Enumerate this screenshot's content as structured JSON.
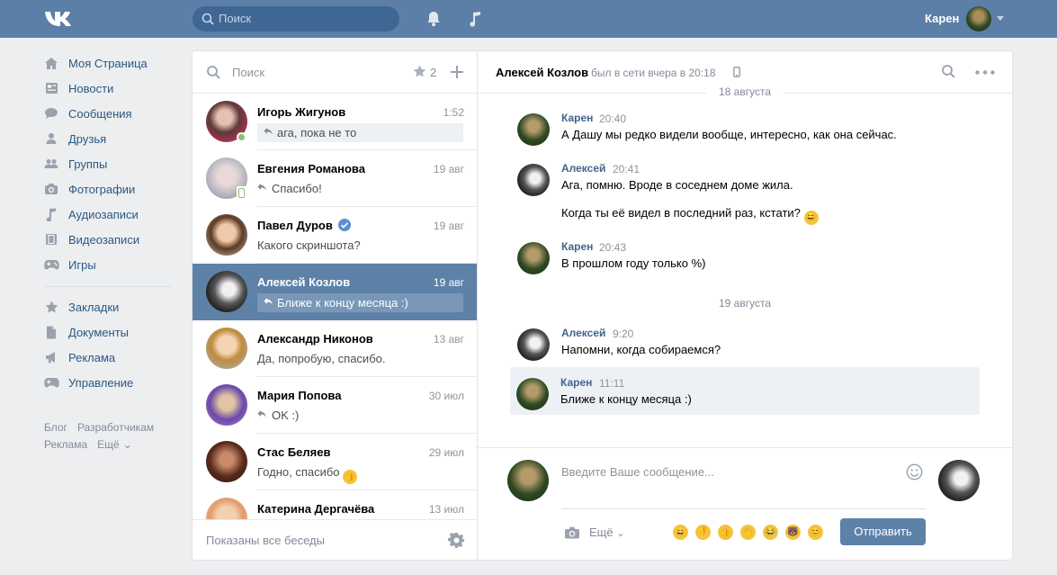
{
  "header": {
    "search_placeholder": "Поиск",
    "user_name": "Карен",
    "brand_color": "#5b7fa6"
  },
  "nav": {
    "items": [
      {
        "label": "Моя Страница",
        "icon": "house-icon"
      },
      {
        "label": "Новости",
        "icon": "news-icon"
      },
      {
        "label": "Сообщения",
        "icon": "message-bubble-icon"
      },
      {
        "label": "Друзья",
        "icon": "person-icon"
      },
      {
        "label": "Группы",
        "icon": "group-icon"
      },
      {
        "label": "Фотографии",
        "icon": "camera-icon"
      },
      {
        "label": "Аудиозаписи",
        "icon": "music-note-icon"
      },
      {
        "label": "Видеозаписи",
        "icon": "film-icon"
      },
      {
        "label": "Игры",
        "icon": "gamepad-icon"
      }
    ],
    "items2": [
      {
        "label": "Закладки",
        "icon": "star-icon"
      },
      {
        "label": "Документы",
        "icon": "document-icon"
      },
      {
        "label": "Реклама",
        "icon": "megaphone-icon"
      },
      {
        "label": "Управление",
        "icon": "gamepad-icon"
      }
    ],
    "footer": [
      "Блог",
      "Разработчикам",
      "Реклама",
      "Ещё"
    ]
  },
  "dialogs": {
    "search_placeholder": "Поиск",
    "favorites_count": "2",
    "items": [
      {
        "name": "Игорь Жигунов",
        "time": "1:52",
        "preview": "ага, пока не то",
        "avatar": "igor"
      },
      {
        "name": "Евгения Романова",
        "time": "19 авг",
        "preview": "Спасибо!",
        "avatar": "evg"
      },
      {
        "name": "Павел Дуров",
        "time": "19 авг",
        "preview": "Какого скриншота?",
        "avatar": "pavel"
      },
      {
        "name": "Алексей Козлов",
        "time": "19 авг",
        "preview": "Ближе к концу месяца :)",
        "avatar": "alexey"
      },
      {
        "name": "Александр Никонов",
        "time": "13 авг",
        "preview": "Да, попробую, спасибо.",
        "avatar": "alex"
      },
      {
        "name": "Мария Попова",
        "time": "30 июл",
        "preview": "OK :)",
        "avatar": "maria"
      },
      {
        "name": "Стас Беляев",
        "time": "29 июл",
        "preview": "Годно, спасибо",
        "avatar": "stas"
      },
      {
        "name": "Катерина Дергачёва",
        "time": "13 июл",
        "preview": "",
        "avatar": "kat"
      }
    ],
    "footer_text": "Показаны все беседы"
  },
  "chat": {
    "contact_name": "Алексей Козлов",
    "status": "был в сети вчера в 20:18",
    "dates": [
      "18 августа",
      "19 августа"
    ],
    "messages": [
      {
        "author": "Карен",
        "time": "20:40",
        "lines": [
          "А Дашу мы редко видели вообще, интересно, как она сейчас."
        ]
      },
      {
        "author": "Алексей",
        "time": "20:41",
        "lines": [
          "Ага, помню. Вроде в соседнем доме жила.",
          "Когда ты её видел в последний раз, кстати?"
        ]
      },
      {
        "author": "Карен",
        "time": "20:43",
        "lines": [
          "В прошлом году только %)"
        ]
      },
      {
        "author": "Алексей",
        "time": "9:20",
        "lines": [
          "Напомни, когда собираемся?"
        ]
      },
      {
        "author": "Карен",
        "time": "11:11",
        "lines": [
          "Ближе к концу месяца :)"
        ]
      }
    ],
    "composer": {
      "placeholder": "Введите Ваше сообщение...",
      "more_label": "Ещё",
      "send_label": "Отправить",
      "emojis": [
        "😄",
        "👎",
        "👍",
        "👋",
        "😂",
        "🐻",
        "😊"
      ]
    }
  }
}
